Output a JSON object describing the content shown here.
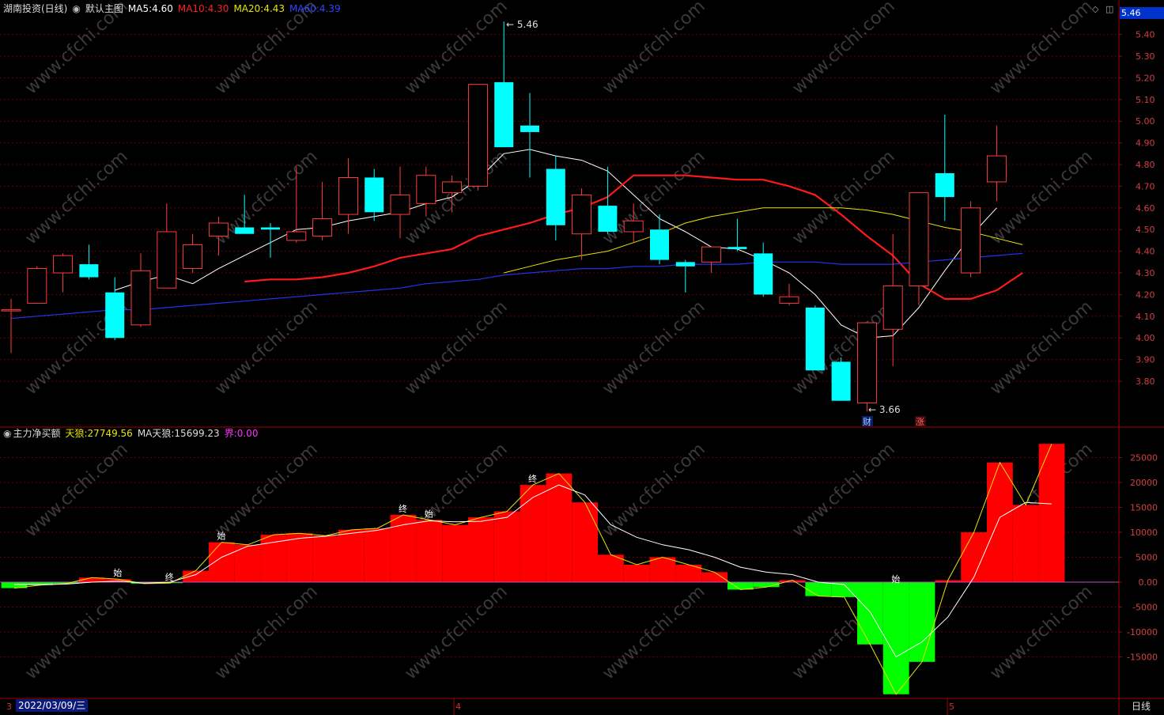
{
  "header": {
    "stock_name": "湖南投资(日线)",
    "template": "默认主图",
    "ma5_label": "MA5:",
    "ma5_value": "4.60",
    "ma10_label": "MA10:",
    "ma10_value": "4.30",
    "ma20_label": "MA20:",
    "ma20_value": "4.43",
    "ma60_label": "MA60:",
    "ma60_value": "4.39"
  },
  "indicator_header": {
    "name": "主力净买额",
    "tianlang_label": "天狼:",
    "tianlang_value": "27749.56",
    "ma_tianlang_label": "MA天狼:",
    "ma_tianlang_value": "15699.23",
    "jie_label": "界:",
    "jie_value": "0.00"
  },
  "colors": {
    "up": "#ff3c3c",
    "down": "#00ffff",
    "ma5": "#ffffff",
    "ma10": "#ff1a1a",
    "ma20": "#e6e600",
    "ma60": "#2233ee",
    "bar_pos": "#ff0000",
    "bar_neg": "#00ff00",
    "grid": "#6b0000"
  },
  "current_price_tag": "5.46",
  "period_label": "日线",
  "crosshair_date": "2022/03/09/三",
  "month_labels": [
    "3",
    "4",
    "5"
  ],
  "event_markers": [
    "财",
    "涨"
  ],
  "watermark": "www.cfchi.com",
  "chart_data": [
    {
      "type": "candlestick",
      "title": "湖南投资(日线)",
      "y_ticks": [
        "5.40",
        "5.30",
        "5.20",
        "5.10",
        "5.00",
        "4.90",
        "4.80",
        "4.70",
        "4.60",
        "4.50",
        "4.40",
        "4.30",
        "4.20",
        "4.10",
        "4.00",
        "3.90",
        "3.80"
      ],
      "ylim": [
        3.66,
        5.48
      ],
      "max_label": "5.46",
      "min_label": "3.66",
      "candles": [
        {
          "o": 4.13,
          "h": 4.18,
          "l": 3.93,
          "c": 4.13
        },
        {
          "o": 4.16,
          "h": 4.33,
          "l": 4.16,
          "c": 4.32
        },
        {
          "o": 4.3,
          "h": 4.39,
          "l": 4.21,
          "c": 4.38
        },
        {
          "o": 4.34,
          "h": 4.43,
          "l": 4.27,
          "c": 4.28
        },
        {
          "o": 4.21,
          "h": 4.28,
          "l": 3.99,
          "c": 4.0
        },
        {
          "o": 4.06,
          "h": 4.39,
          "l": 4.05,
          "c": 4.31
        },
        {
          "o": 4.23,
          "h": 4.62,
          "l": 4.23,
          "c": 4.49
        },
        {
          "o": 4.32,
          "h": 4.48,
          "l": 4.3,
          "c": 4.43
        },
        {
          "o": 4.47,
          "h": 4.56,
          "l": 4.38,
          "c": 4.53
        },
        {
          "o": 4.51,
          "h": 4.66,
          "l": 4.48,
          "c": 4.48
        },
        {
          "o": 4.51,
          "h": 4.53,
          "l": 4.37,
          "c": 4.5
        },
        {
          "o": 4.45,
          "h": 4.79,
          "l": 4.44,
          "c": 4.49
        },
        {
          "o": 4.47,
          "h": 4.72,
          "l": 4.45,
          "c": 4.55
        },
        {
          "o": 4.57,
          "h": 4.83,
          "l": 4.48,
          "c": 4.74
        },
        {
          "o": 4.74,
          "h": 4.78,
          "l": 4.54,
          "c": 4.58
        },
        {
          "o": 4.57,
          "h": 4.79,
          "l": 4.46,
          "c": 4.66
        },
        {
          "o": 4.62,
          "h": 4.79,
          "l": 4.56,
          "c": 4.75
        },
        {
          "o": 4.67,
          "h": 4.75,
          "l": 4.58,
          "c": 4.72
        },
        {
          "o": 4.7,
          "h": 5.17,
          "l": 4.68,
          "c": 5.17
        },
        {
          "o": 5.18,
          "h": 5.46,
          "l": 4.88,
          "c": 4.88
        },
        {
          "o": 4.98,
          "h": 5.13,
          "l": 4.74,
          "c": 4.95
        },
        {
          "o": 4.78,
          "h": 4.84,
          "l": 4.45,
          "c": 4.52
        },
        {
          "o": 4.48,
          "h": 4.69,
          "l": 4.36,
          "c": 4.66
        },
        {
          "o": 4.61,
          "h": 4.79,
          "l": 4.48,
          "c": 4.49
        },
        {
          "o": 4.49,
          "h": 4.62,
          "l": 4.44,
          "c": 4.54
        },
        {
          "o": 4.5,
          "h": 4.57,
          "l": 4.34,
          "c": 4.36
        },
        {
          "o": 4.35,
          "h": 4.36,
          "l": 4.21,
          "c": 4.33
        },
        {
          "o": 4.35,
          "h": 4.42,
          "l": 4.3,
          "c": 4.42
        },
        {
          "o": 4.42,
          "h": 4.55,
          "l": 4.4,
          "c": 4.41
        },
        {
          "o": 4.39,
          "h": 4.44,
          "l": 4.19,
          "c": 4.2
        },
        {
          "o": 4.16,
          "h": 4.25,
          "l": 4.15,
          "c": 4.19
        },
        {
          "o": 4.14,
          "h": 4.15,
          "l": 3.85,
          "c": 3.85
        },
        {
          "o": 3.89,
          "h": 3.91,
          "l": 3.72,
          "c": 3.71
        },
        {
          "o": 3.7,
          "h": 4.07,
          "l": 3.66,
          "c": 4.07
        },
        {
          "o": 4.04,
          "h": 4.48,
          "l": 3.87,
          "c": 4.24
        },
        {
          "o": 4.24,
          "h": 4.67,
          "l": 4.15,
          "c": 4.67
        },
        {
          "o": 4.76,
          "h": 5.03,
          "l": 4.54,
          "c": 4.65
        },
        {
          "o": 4.3,
          "h": 4.63,
          "l": 4.28,
          "c": 4.6
        },
        {
          "o": 4.72,
          "h": 4.98,
          "l": 4.63,
          "c": 4.84
        }
      ],
      "series": [
        {
          "name": "MA5",
          "values": [
            null,
            null,
            null,
            null,
            4.22,
            4.26,
            4.29,
            4.25,
            4.32,
            4.38,
            4.44,
            4.5,
            4.51,
            4.54,
            4.56,
            4.58,
            4.62,
            4.65,
            4.73,
            4.85,
            4.87,
            4.84,
            4.82,
            4.77,
            4.66,
            4.55,
            4.49,
            4.42,
            4.41,
            4.36,
            4.3,
            4.2,
            4.06,
            4.0,
            4.01,
            4.14,
            4.31,
            4.47,
            4.6
          ]
        },
        {
          "name": "MA10",
          "values": [
            null,
            null,
            null,
            null,
            null,
            null,
            null,
            null,
            null,
            4.26,
            4.27,
            4.27,
            4.28,
            4.3,
            4.33,
            4.37,
            4.39,
            4.41,
            4.47,
            4.5,
            4.53,
            4.57,
            4.6,
            4.65,
            4.75,
            4.75,
            4.75,
            4.74,
            4.73,
            4.73,
            4.7,
            4.66,
            4.57,
            4.47,
            4.38,
            4.25,
            4.18,
            4.18,
            4.22,
            4.3
          ]
        },
        {
          "name": "MA20",
          "values": [
            null,
            null,
            null,
            null,
            null,
            null,
            null,
            null,
            null,
            null,
            null,
            null,
            null,
            null,
            null,
            null,
            null,
            null,
            null,
            4.3,
            4.33,
            4.36,
            4.38,
            4.4,
            4.44,
            4.48,
            4.53,
            4.56,
            4.58,
            4.6,
            4.6,
            4.6,
            4.6,
            4.59,
            4.57,
            4.54,
            4.51,
            4.49,
            4.46,
            4.43
          ]
        },
        {
          "name": "MA60",
          "values": [
            4.09,
            4.1,
            4.11,
            4.12,
            4.13,
            4.13,
            4.14,
            4.15,
            4.16,
            4.17,
            4.18,
            4.19,
            4.2,
            4.21,
            4.22,
            4.23,
            4.25,
            4.26,
            4.27,
            4.29,
            4.3,
            4.31,
            4.32,
            4.32,
            4.33,
            4.33,
            4.34,
            4.34,
            4.34,
            4.35,
            4.35,
            4.35,
            4.34,
            4.34,
            4.34,
            4.35,
            4.36,
            4.37,
            4.38,
            4.39
          ]
        }
      ]
    },
    {
      "type": "bar",
      "title": "主力净买额",
      "y_ticks": [
        "25000",
        "20000",
        "15000",
        "10000",
        "5000",
        "0.00",
        "-5000",
        "-10000",
        "-15000"
      ],
      "ylim": [
        -22500,
        29000
      ],
      "values": [
        -1200,
        -600,
        -300,
        900,
        600,
        -300,
        -200,
        2300,
        8000,
        7500,
        9500,
        9800,
        9300,
        10500,
        10800,
        13500,
        12500,
        11500,
        13000,
        14200,
        19500,
        21800,
        16000,
        5500,
        3500,
        5000,
        3500,
        2000,
        -1500,
        -1000,
        400,
        -2800,
        -3000,
        -12500,
        -22500,
        -16000,
        400,
        10000,
        24000,
        15500,
        27749.56
      ],
      "ma_values": [
        -500,
        -500,
        -400,
        0,
        200,
        -200,
        0,
        1500,
        5000,
        7200,
        8000,
        8800,
        9200,
        9800,
        10400,
        11500,
        12300,
        12100,
        12200,
        13000,
        17000,
        19500,
        17500,
        11500,
        9000,
        7500,
        6500,
        5000,
        3000,
        2000,
        1500,
        0,
        -500,
        -6000,
        -15000,
        -12000,
        -7000,
        1000,
        13000,
        16000,
        15699.23
      ],
      "labels": [
        {
          "text": "始",
          "index": 4
        },
        {
          "text": "终",
          "index": 6
        },
        {
          "text": "始",
          "index": 8
        },
        {
          "text": "终",
          "index": 15
        },
        {
          "text": "始",
          "index": 16
        },
        {
          "text": "终",
          "index": 20
        },
        {
          "text": "始",
          "index": 34
        }
      ]
    }
  ]
}
